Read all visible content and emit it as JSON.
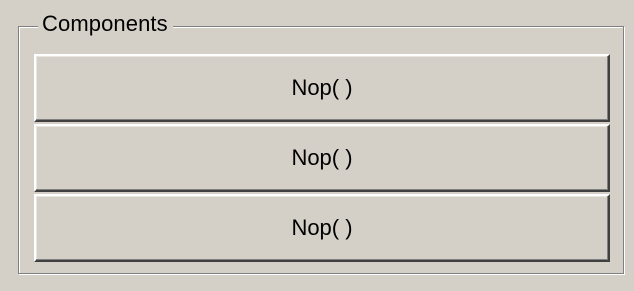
{
  "components_group": {
    "title": "Components",
    "buttons": [
      {
        "label": "Nop( )"
      },
      {
        "label": "Nop( )"
      },
      {
        "label": "Nop( )"
      }
    ]
  }
}
